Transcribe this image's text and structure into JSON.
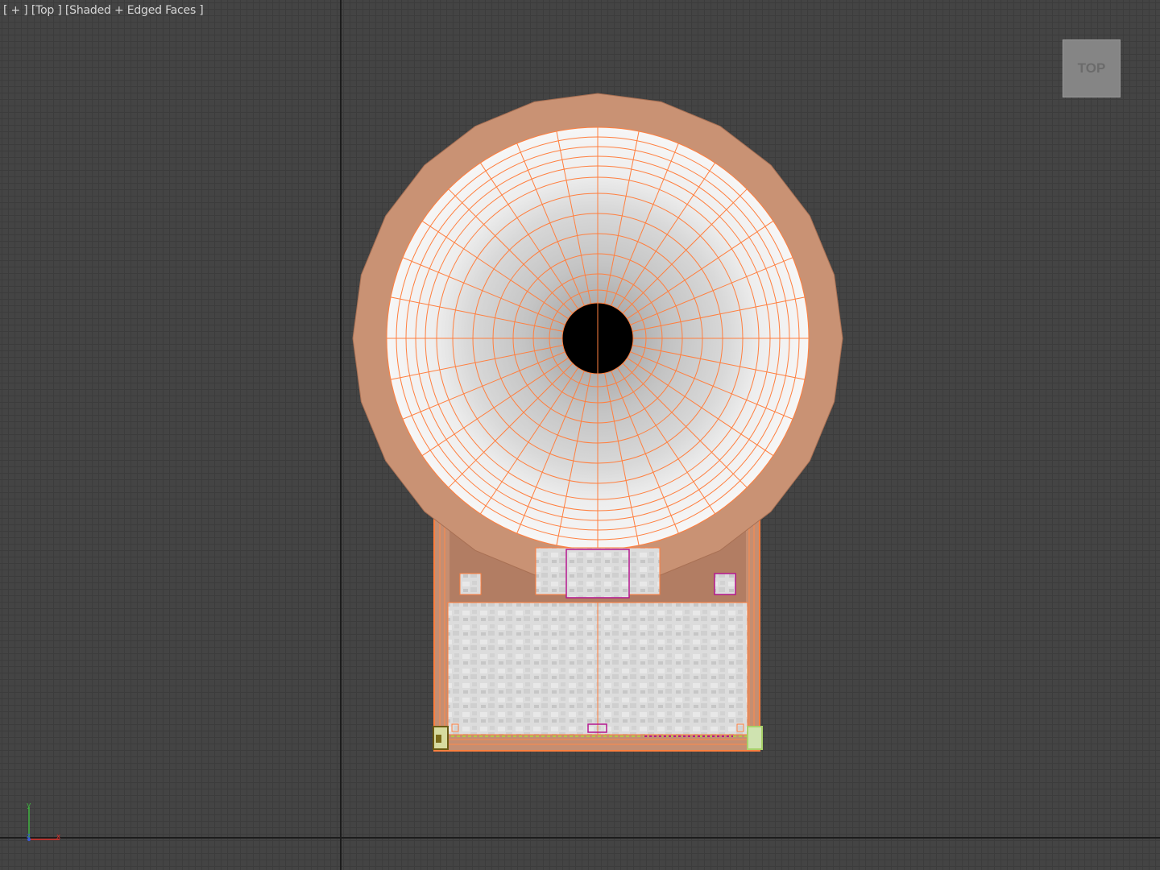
{
  "viewport": {
    "plus_menu": "[ + ]",
    "view_menu": "[Top ]",
    "shading_menu": "[Shaded + Edged Faces ]"
  },
  "viewcube": {
    "face_label": "TOP"
  },
  "axis_tripod": {
    "x_label": "x",
    "y_label": "y",
    "z_label": "z"
  },
  "colors": {
    "viewport_bg": "#444444",
    "grid": "#3c3c3c",
    "world_axis": "#1c1c1c",
    "mesh_orange": "#c99274",
    "edge_orange": "#ff7f3f",
    "texture_light": "#e0e0e0",
    "selection_magenta": "#b5178f"
  }
}
